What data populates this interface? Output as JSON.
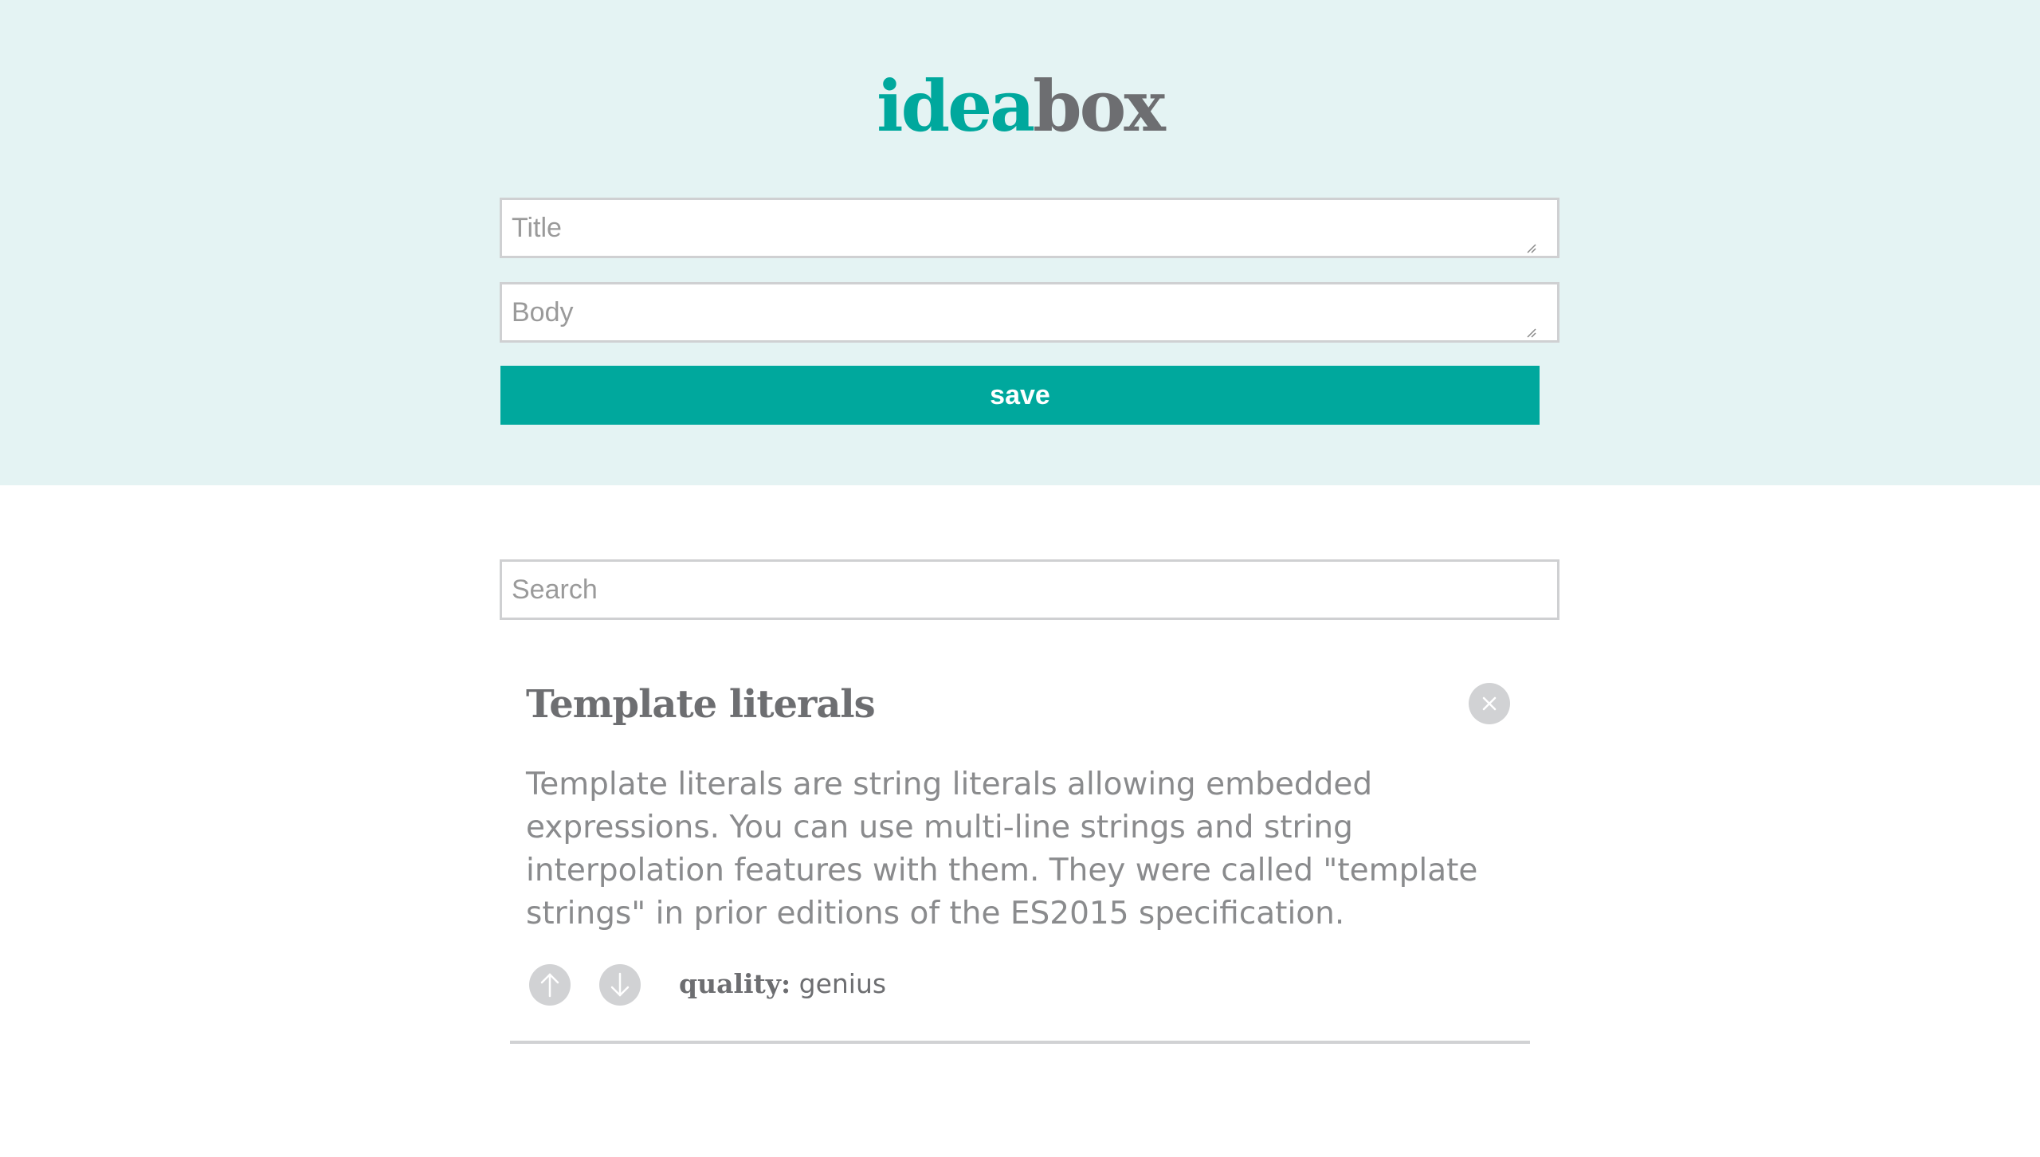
{
  "header": {
    "logo_part1": "idea",
    "logo_part2": "box"
  },
  "form": {
    "title_placeholder": "Title",
    "body_placeholder": "Body",
    "save_label": "save"
  },
  "search": {
    "placeholder": "Search"
  },
  "ideas": [
    {
      "title": "Template literals",
      "body": "Template literals are string literals allowing embedded expressions. You can use multi-line strings and string interpolation features with them. They were called \"template strings\" in prior editions of the ES2015 specification.",
      "quality_label": "quality:",
      "quality_value": "genius"
    }
  ],
  "colors": {
    "accent": "#00a89d",
    "text": "#6d6e71",
    "header_bg": "#e4f3f3"
  }
}
